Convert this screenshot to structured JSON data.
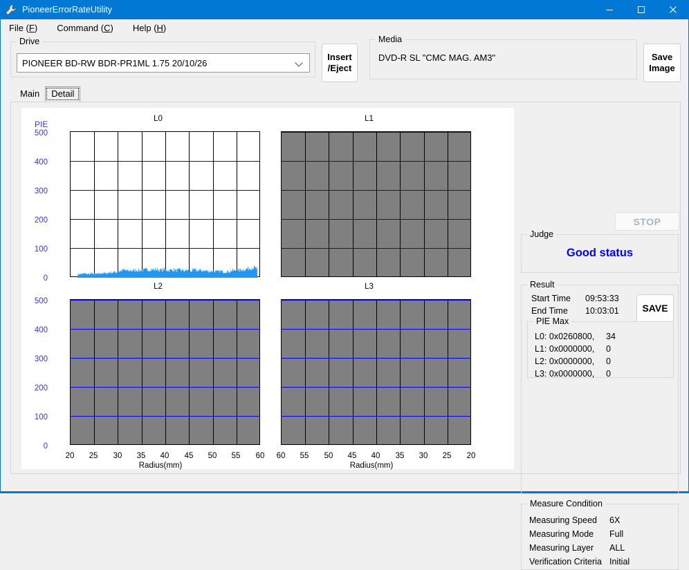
{
  "window": {
    "title": "PioneerErrorRateUtility",
    "icon": "wrench-icon",
    "accent_color": "#0078d4",
    "buttons": {
      "minimize": "minimize-icon",
      "maximize": "maximize-icon",
      "close": "close-icon"
    }
  },
  "menu": [
    {
      "label": "File (F)",
      "text": "File (",
      "mnemonic": "F",
      "tail": ")"
    },
    {
      "label": "Command (C)",
      "text": "Command (",
      "mnemonic": "C",
      "tail": ")"
    },
    {
      "label": "Help (H)",
      "text": "Help (",
      "mnemonic": "H",
      "tail": ")"
    }
  ],
  "drive": {
    "legend": "Drive",
    "selected": "PIONEER BD-RW  BDR-PR1ML 1.75 20/10/26",
    "options": [
      "PIONEER BD-RW  BDR-PR1ML 1.75 20/10/26"
    ]
  },
  "insert_eject": {
    "line1": "Insert",
    "line2": "/Eject"
  },
  "save_image": {
    "line1": "Save",
    "line2": "Image"
  },
  "media": {
    "legend": "Media",
    "value": "DVD-R SL \"CMC MAG. AM3\""
  },
  "tabs": [
    {
      "label": "Main",
      "active": false
    },
    {
      "label": "Detail",
      "active": true
    }
  ],
  "stop_button": {
    "label": "STOP",
    "enabled": false,
    "disabled_color": "#a8b6c8"
  },
  "judge": {
    "legend": "Judge",
    "value": "Good status",
    "color": "#0000ff"
  },
  "result": {
    "legend": "Result",
    "start_time_label": "Start Time",
    "start_time_value": "09:53:33",
    "end_time_label": "End Time",
    "end_time_value": "10:03:01",
    "save_label": "SAVE",
    "pie_max": {
      "legend": "PIE Max",
      "rows": [
        {
          "layer": "L0:",
          "address": "0x0260800,",
          "value": "34"
        },
        {
          "layer": "L1:",
          "address": "0x0000000,",
          "value": "0"
        },
        {
          "layer": "L2:",
          "address": "0x0000000,",
          "value": "0"
        },
        {
          "layer": "L3:",
          "address": "0x0000000,",
          "value": "0"
        }
      ]
    }
  },
  "measure_condition": {
    "legend": "Measure Condition",
    "rows": [
      {
        "key": "Measuring Speed",
        "value": "6X"
      },
      {
        "key": "Measuring Mode",
        "value": "Full"
      },
      {
        "key": "Measuring Layer",
        "value": "ALL"
      },
      {
        "key": "Verification Criteria",
        "value": "Initial"
      }
    ]
  },
  "chart_data": {
    "type": "area",
    "title": "PIE",
    "ylabel": "PIE",
    "xlabel": "Radius(mm)",
    "ylim": [
      0,
      500
    ],
    "yticks": [
      0,
      100,
      200,
      300,
      400,
      500
    ],
    "ytick_color": "#3333ff",
    "grid": true,
    "gridline_color": "#0000ff",
    "series_color": "#2196f3",
    "panels": [
      {
        "name": "L0",
        "active": true,
        "x": [
          20,
          25,
          30,
          35,
          40,
          45,
          50,
          55,
          60
        ],
        "xticks": [
          "20",
          "25",
          "30",
          "35",
          "40",
          "45",
          "50",
          "55",
          "60"
        ],
        "xlim": [
          20,
          60
        ],
        "values": [
          11,
          13,
          12,
          14,
          13,
          12,
          13,
          14,
          13,
          12,
          13,
          14,
          16,
          15,
          14,
          16,
          18,
          17,
          19,
          18,
          20,
          22,
          24,
          26,
          24,
          22,
          25,
          23,
          24,
          26,
          25,
          24,
          26,
          25,
          27,
          26,
          28,
          27,
          26,
          28,
          27,
          25,
          26,
          28,
          26,
          24,
          25,
          27,
          26,
          24,
          25,
          26,
          24,
          23,
          25,
          24,
          22,
          24,
          26,
          25,
          23,
          25,
          24,
          22,
          23,
          22,
          21,
          23,
          22,
          20,
          21,
          22,
          20,
          19,
          21,
          20,
          22,
          24,
          23,
          25,
          24,
          26,
          28,
          27,
          29,
          31,
          33,
          34,
          32,
          30
        ]
      },
      {
        "name": "L1",
        "active": false,
        "xticks": [
          "60",
          "55",
          "50",
          "45",
          "40",
          "35",
          "30",
          "25",
          "20"
        ],
        "xlim": [
          60,
          20
        ],
        "values": []
      },
      {
        "name": "L2",
        "active": false,
        "xticks": [
          "20",
          "25",
          "30",
          "35",
          "40",
          "45",
          "50",
          "55",
          "60"
        ],
        "xlim": [
          20,
          60
        ],
        "values": []
      },
      {
        "name": "L3",
        "active": false,
        "xticks": [
          "60",
          "55",
          "50",
          "45",
          "40",
          "35",
          "30",
          "25",
          "20"
        ],
        "xlim": [
          60,
          20
        ],
        "values": []
      }
    ]
  }
}
